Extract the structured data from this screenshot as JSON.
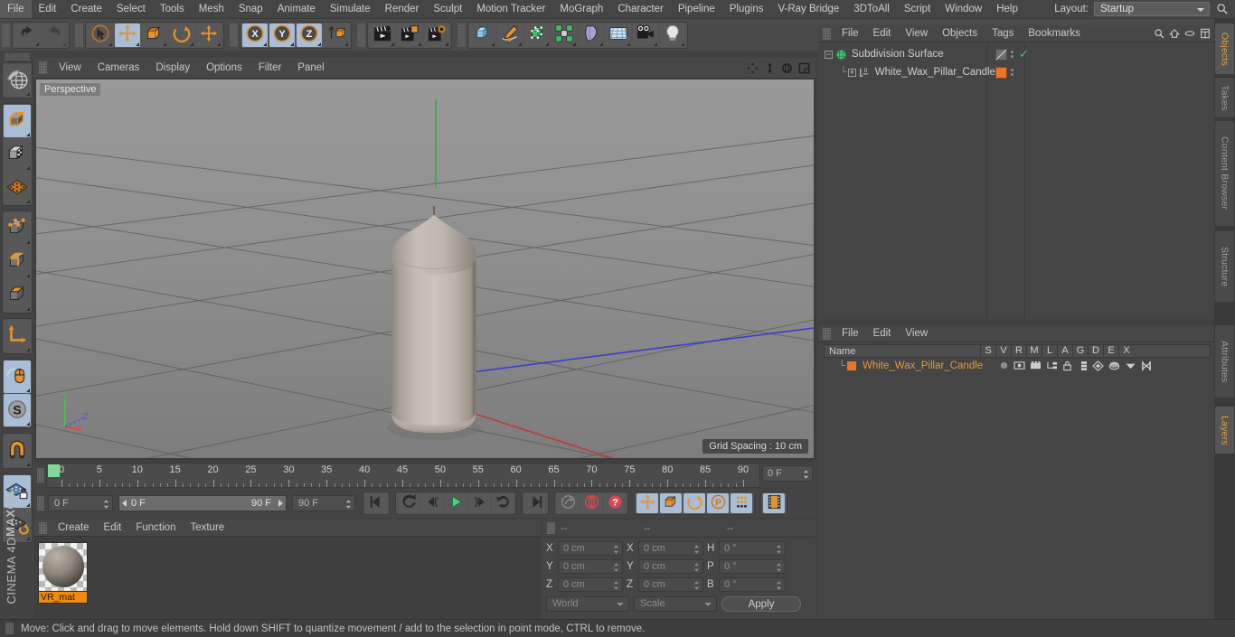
{
  "menubar": {
    "items": [
      "File",
      "Edit",
      "Create",
      "Select",
      "Tools",
      "Mesh",
      "Snap",
      "Animate",
      "Simulate",
      "Render",
      "Sculpt",
      "Motion Tracker",
      "MoGraph",
      "Character",
      "Pipeline",
      "Plugins",
      "V-Ray Bridge",
      "3DToAll",
      "Script",
      "Window",
      "Help"
    ],
    "layout_label": "Layout:",
    "layout_value": "Startup",
    "search_icon": "magnifier-icon"
  },
  "toolbar": {
    "groups": [
      {
        "name": "history",
        "buttons": [
          {
            "name": "undo-button",
            "icon": "undo-arrow-icon",
            "state": "normal"
          },
          {
            "name": "redo-button",
            "icon": "redo-arrow-icon",
            "state": "disabled"
          }
        ]
      },
      {
        "name": "transform-tools",
        "buttons": [
          {
            "name": "live-selection-tool",
            "icon": "cursor-circle-icon",
            "state": "normal"
          },
          {
            "name": "move-tool",
            "icon": "move-arrows-icon",
            "state": "selected"
          },
          {
            "name": "scale-tool",
            "icon": "scale-box-icon",
            "state": "normal"
          },
          {
            "name": "rotate-tool",
            "icon": "rotate-ring-icon",
            "state": "normal"
          },
          {
            "name": "add-tool",
            "icon": "plus-arrows-icon",
            "state": "normal"
          }
        ]
      },
      {
        "name": "axis-locks",
        "buttons": [
          {
            "name": "lock-x-axis",
            "icon": "x-axis-icon",
            "state": "selected"
          },
          {
            "name": "lock-y-axis",
            "icon": "y-axis-icon",
            "state": "selected"
          },
          {
            "name": "lock-z-axis",
            "icon": "z-axis-icon",
            "state": "selected"
          },
          {
            "name": "world-object-coordinates",
            "icon": "world-cube-icon",
            "state": "normal"
          }
        ]
      },
      {
        "name": "render-tools",
        "buttons": [
          {
            "name": "render-view-button",
            "icon": "clapper-icon",
            "state": "normal"
          },
          {
            "name": "render-to-picture-viewer",
            "icon": "clapper-window-icon",
            "state": "normal"
          },
          {
            "name": "edit-render-settings",
            "icon": "clapper-gear-icon",
            "state": "normal"
          }
        ]
      },
      {
        "name": "create-objects",
        "buttons": [
          {
            "name": "add-primitive-cube",
            "icon": "blue-cube-icon",
            "state": "normal"
          },
          {
            "name": "add-spline-pen",
            "icon": "pen-spline-icon",
            "state": "normal"
          },
          {
            "name": "add-generator",
            "icon": "green-cube-icon",
            "state": "normal"
          },
          {
            "name": "add-mograph-cloner",
            "icon": "green-cluster-icon",
            "state": "normal"
          },
          {
            "name": "add-deformer",
            "icon": "bend-deformer-icon",
            "state": "normal"
          },
          {
            "name": "add-environment",
            "icon": "floor-grid-icon",
            "state": "normal"
          },
          {
            "name": "add-camera",
            "icon": "camera-icon",
            "state": "normal"
          },
          {
            "name": "add-light",
            "icon": "light-bulb-icon",
            "state": "normal"
          }
        ]
      }
    ]
  },
  "left_toolbar": {
    "groups": [
      [
        {
          "name": "make-editable-tool",
          "icon": "globe-mesh-icon",
          "state": "normal"
        }
      ],
      [
        {
          "name": "model-mode",
          "icon": "model-cube-icon",
          "state": "selected"
        },
        {
          "name": "texture-mode",
          "icon": "texture-checker-cube-icon",
          "state": "normal"
        },
        {
          "name": "workplane-mode",
          "icon": "workplane-grid-icon",
          "state": "normal"
        }
      ],
      [
        {
          "name": "points-mode",
          "icon": "points-cube-icon",
          "state": "normal"
        },
        {
          "name": "edges-mode",
          "icon": "edges-cube-icon",
          "state": "normal"
        },
        {
          "name": "polygons-mode",
          "icon": "polygons-cube-icon",
          "state": "normal"
        }
      ],
      [
        {
          "name": "object-axis-mode",
          "icon": "axis-L-icon",
          "state": "normal"
        }
      ],
      [
        {
          "name": "enable-axis-modification",
          "icon": "mouse-axis-icon",
          "state": "selected"
        },
        {
          "name": "enable-snapping",
          "icon": "snap-S-icon",
          "state": "selected"
        }
      ],
      [
        {
          "name": "magnet-tool",
          "icon": "magnet-icon",
          "state": "normal"
        }
      ],
      [
        {
          "name": "lock-workplane",
          "icon": "workplane-lock-icon",
          "state": "selected"
        },
        {
          "name": "planar-workplane-toggle",
          "icon": "workplane-rotate-icon",
          "state": "normal"
        }
      ]
    ],
    "brand_line1": "MAXON",
    "brand_line2": "CINEMA 4D"
  },
  "viewport": {
    "menu_items": [
      "View",
      "Cameras",
      "Display",
      "Options",
      "Filter",
      "Panel"
    ],
    "nav_icons": [
      "pan-icon",
      "dolly-icon",
      "rotate-icon",
      "maximize-icon"
    ],
    "label": "Perspective",
    "grid_spacing": "Grid Spacing : 10 cm",
    "axis_gizmo": {
      "x": "X",
      "y": "Y",
      "z": "Z",
      "x_color": "#e04a3c",
      "y_color": "#3fc44a",
      "z_color": "#4a5ce0"
    },
    "object_color": "#b3aca2",
    "background_color": "#8b8b8b"
  },
  "timeline": {
    "ticks": [
      0,
      5,
      10,
      15,
      20,
      25,
      30,
      35,
      40,
      45,
      50,
      55,
      60,
      65,
      70,
      75,
      80,
      85,
      90
    ],
    "playhead_frame": 0,
    "current_frame_field": "0 F"
  },
  "transport": {
    "start_field": "0 F",
    "range_start": "0 F",
    "range_end": "90 F",
    "end_field": "90 F",
    "buttons": [
      {
        "name": "go-to-start-button",
        "icon": "skip-start-icon"
      },
      {
        "name": "play-backwards-button",
        "icon": "rewind-arrow-icon"
      },
      {
        "name": "previous-frame-button",
        "icon": "step-back-icon"
      },
      {
        "name": "play-forward-button",
        "icon": "play-triangle-icon"
      },
      {
        "name": "next-frame-button",
        "icon": "step-forward-icon"
      },
      {
        "name": "play-forward-loop-button",
        "icon": "loop-arrow-icon"
      },
      {
        "name": "go-to-end-button",
        "icon": "skip-end-icon"
      },
      {
        "name": "record-active-objects-button",
        "icon": "record-key-icon"
      },
      {
        "name": "autokeying-button",
        "icon": "autokey-circle-icon"
      },
      {
        "name": "keyframe-selection-button",
        "icon": "question-circle-icon"
      },
      {
        "name": "position-key-button",
        "icon": "move-arrows-icon"
      },
      {
        "name": "scale-key-button",
        "icon": "scale-box-icon"
      },
      {
        "name": "rotation-key-button",
        "icon": "rotate-ring-icon"
      },
      {
        "name": "parameter-key-button",
        "icon": "p-circle-icon"
      },
      {
        "name": "point-level-animation-button",
        "icon": "dots-grid-icon"
      },
      {
        "name": "animation-mode-button",
        "icon": "film-strip-icon"
      }
    ]
  },
  "material_manager": {
    "menu_items": [
      "Create",
      "Edit",
      "Function",
      "Texture"
    ],
    "materials": [
      {
        "name": "VR_mat",
        "label_color": "#f08a0e"
      }
    ]
  },
  "coordinates": {
    "header_cols": [
      "--",
      "--",
      "--"
    ],
    "rows": [
      {
        "axis1": "X",
        "value1": "0 cm",
        "axis2": "X",
        "value2": "0 cm",
        "axis3": "H",
        "value3": "0 °"
      },
      {
        "axis1": "Y",
        "value1": "0 cm",
        "axis2": "Y",
        "value2": "0 cm",
        "axis3": "P",
        "value3": "0 °"
      },
      {
        "axis1": "Z",
        "value1": "0 cm",
        "axis2": "Z",
        "value2": "0 cm",
        "axis3": "B",
        "value3": "0 °"
      }
    ],
    "coord_system": "World",
    "size_mode": "Scale",
    "apply_label": "Apply"
  },
  "object_manager": {
    "menu_items": [
      "File",
      "Edit",
      "View",
      "Objects",
      "Tags",
      "Bookmarks"
    ],
    "header_icons": [
      "magnifier-icon",
      "home-icon",
      "ellipse-icon",
      "layout-icon"
    ],
    "objects": [
      {
        "name": "Subdivision Surface",
        "icon": "subdivision-surface-icon",
        "icon_color": "#3ec46b",
        "depth": 0,
        "tag_color": "#8c8c8c",
        "tag_type": "diagonal",
        "check": true
      },
      {
        "name": "White_Wax_Pillar_Candle",
        "icon": "polygon-object-icon",
        "icon_color": "#d8d8d8",
        "depth": 1,
        "tag_color": "#e8752b",
        "tag_type": "solid",
        "check": false
      }
    ]
  },
  "layer_manager": {
    "menu_items": [
      "File",
      "Edit",
      "View"
    ],
    "columns": [
      "Name",
      "S",
      "V",
      "R",
      "M",
      "L",
      "A",
      "G",
      "D",
      "E",
      "X"
    ],
    "rows": [
      {
        "name": "White_Wax_Pillar_Candle",
        "swatch": "#e8752b",
        "text_color": "#e09a3e"
      }
    ]
  },
  "vertical_tabs": [
    {
      "label": "Objects",
      "active": true
    },
    {
      "label": "Takes",
      "active": false
    },
    {
      "label": "Content Browser",
      "active": false
    },
    {
      "label": "Structure",
      "active": false
    },
    {
      "label": "Attributes",
      "active": false
    },
    {
      "label": "Layers",
      "active": true
    }
  ],
  "statusbar": {
    "message": "Move: Click and drag to move elements. Hold down SHIFT to quantize movement / add to the selection in point mode, CTRL to remove."
  }
}
